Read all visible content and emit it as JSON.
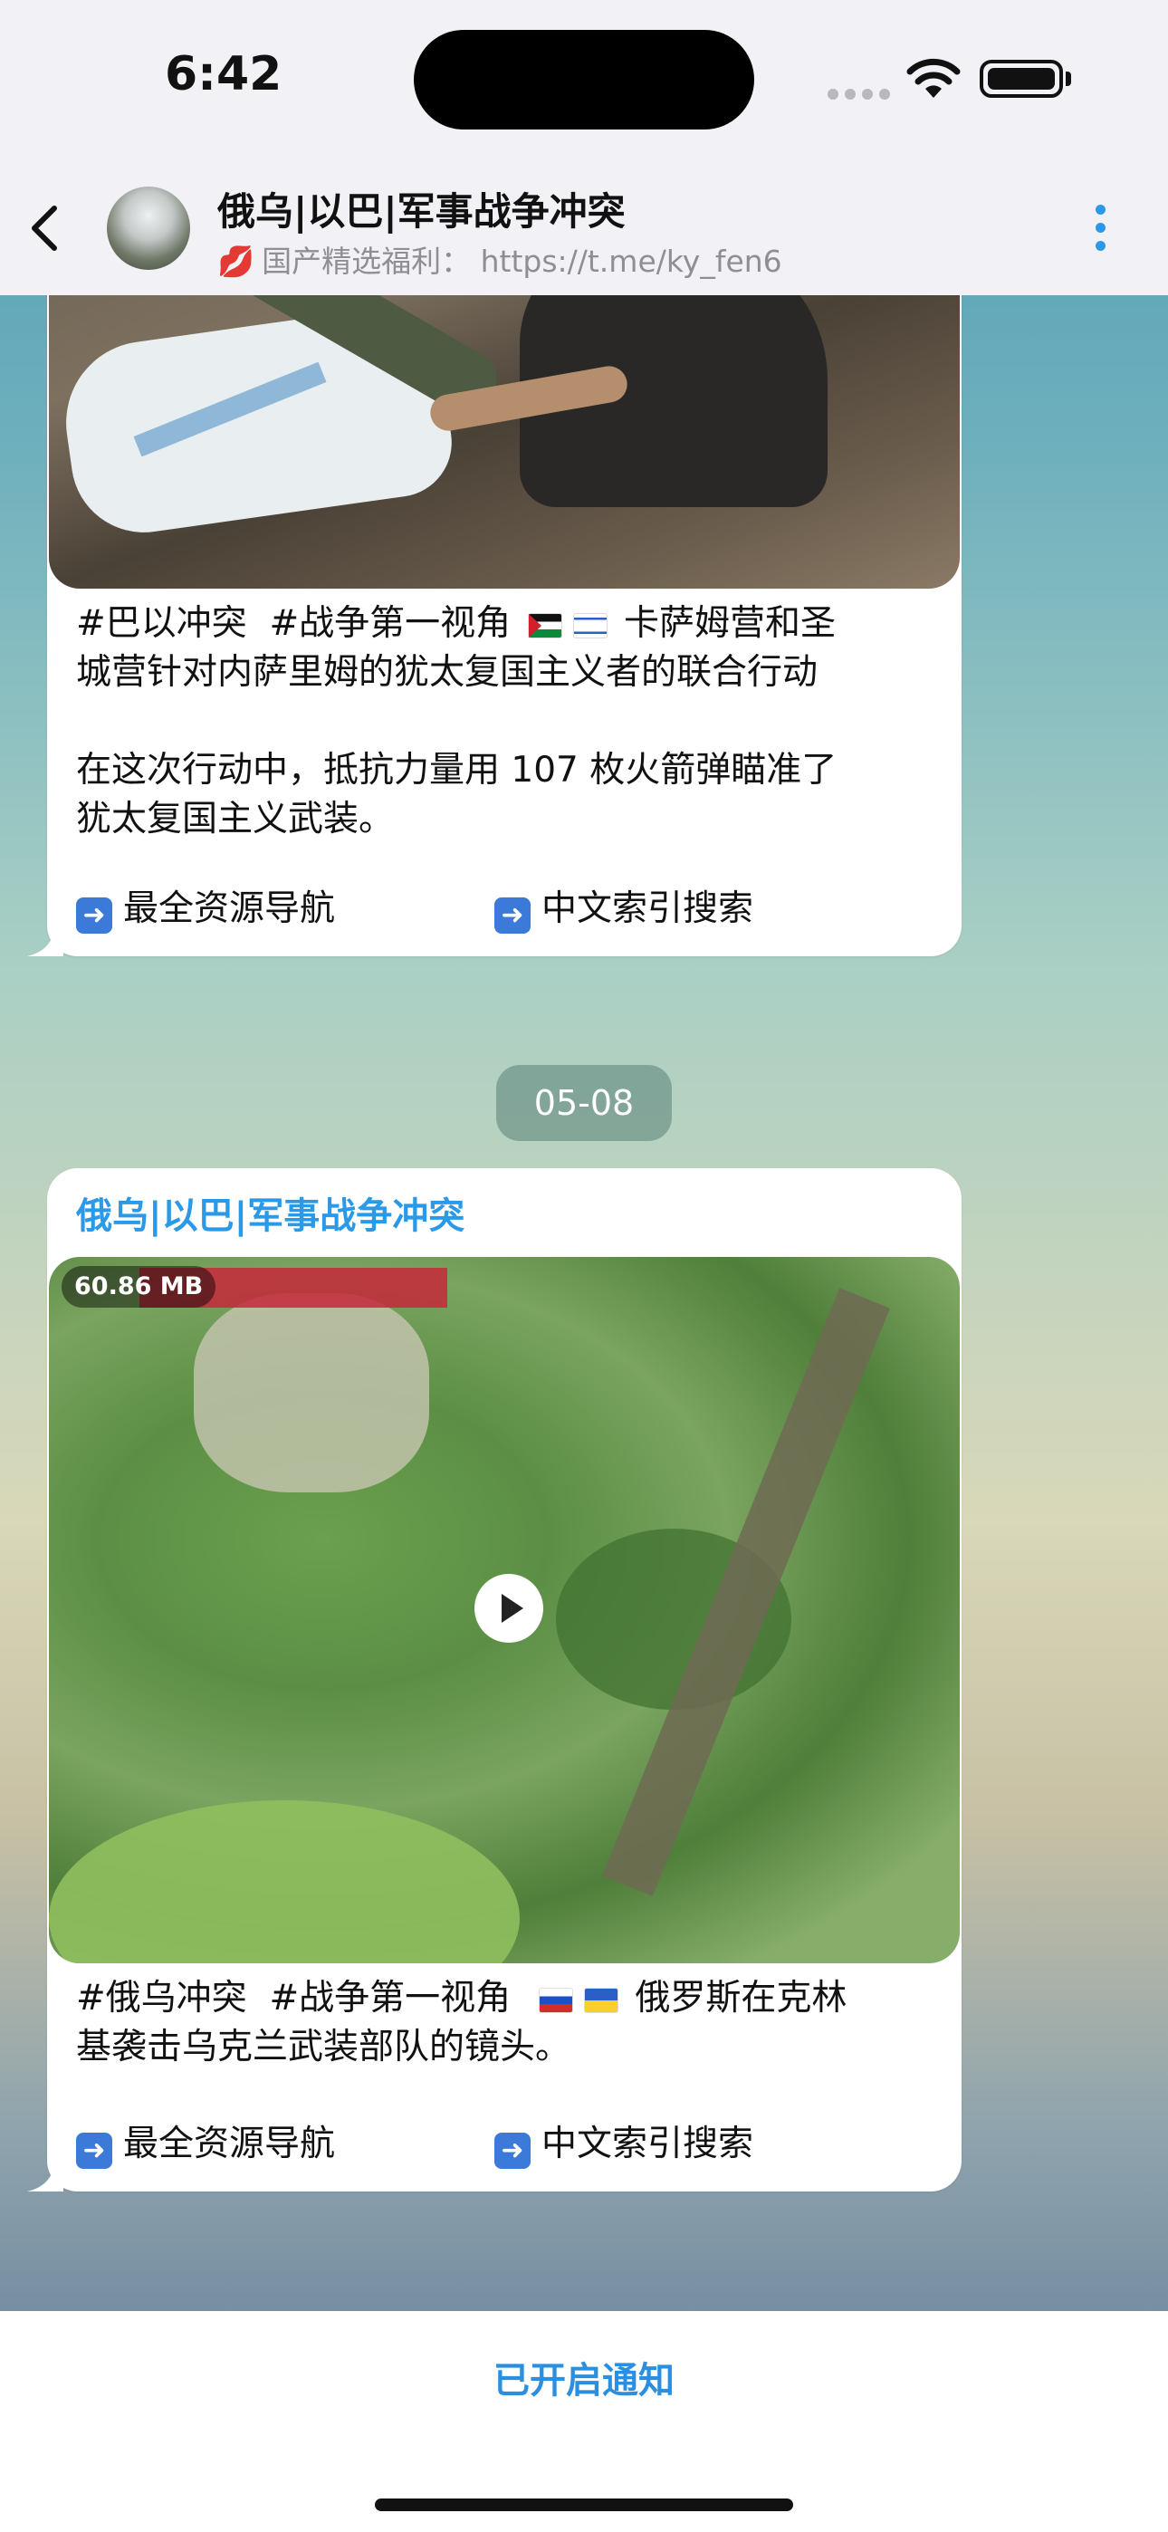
{
  "status_bar": {
    "time": "6:42"
  },
  "header": {
    "title": "俄乌|以巴|军事战争冲突",
    "subtitle_emoji": "💋",
    "subtitle": "国产精选福利：  https://t.me/ky_fen6"
  },
  "messages": [
    {
      "text": "#巴以冲突  #战争第一视角 {ps} {il}  卡萨姆营和圣\n城营针对内萨里姆的犹太复国主义者的联合行动\n\n在这次行动中，抵抗力量用 107 枚火箭弹瞄准了\n犹太复国主义武装。",
      "line1": "#巴以冲突  #战争第一视角",
      "line1_tail": " 卡萨姆营和圣",
      "line2": "城营针对内萨里姆的犹太复国主义者的联合行动",
      "line3": "在这次行动中，抵抗力量用 107 枚火箭弹瞄准了",
      "line4": "犹太复国主义武装。",
      "buttons": [
        "最全资源导航",
        "中文索引搜索"
      ]
    },
    {
      "sender": "俄乌|以巴|军事战争冲突",
      "video_size": "60.86 MB",
      "line1": "#俄乌冲突  #战争第一视角",
      "line1_tail": " 俄罗斯在克林",
      "line2": "基袭击乌克兰武装部队的镜头。",
      "buttons": [
        "最全资源导航",
        "中文索引搜索"
      ]
    }
  ],
  "date_separator": "05-08",
  "bottom": {
    "notify_label": "已开启通知"
  },
  "icons": {
    "back": "chevron-left-icon",
    "more": "more-vertical-icon",
    "arrow": "right-arrow-icon",
    "play": "play-icon"
  },
  "colors": {
    "accent": "#2a9ae8",
    "notify": "#2a8fe0"
  }
}
